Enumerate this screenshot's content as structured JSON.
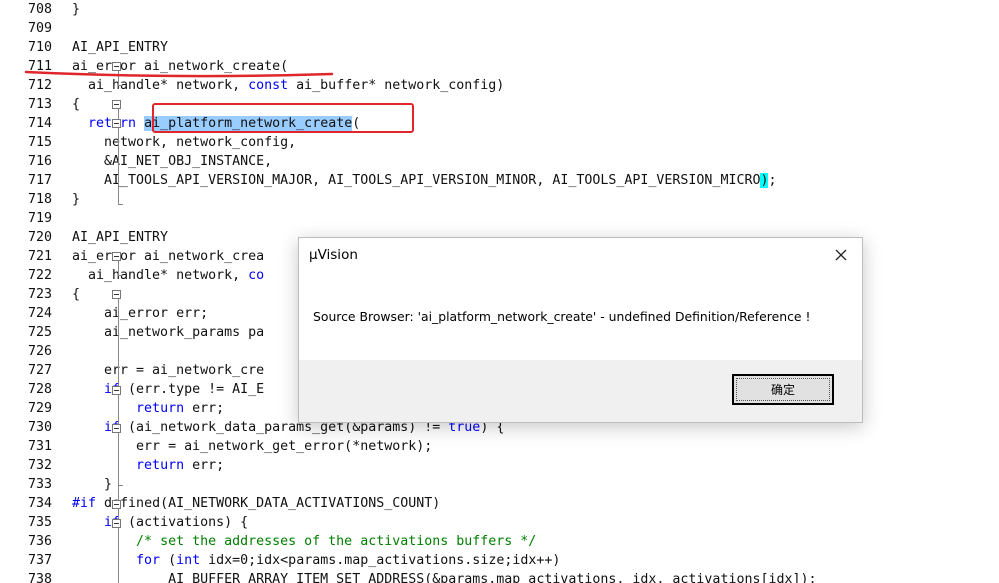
{
  "editor": {
    "lines": [
      {
        "n": "708",
        "segs": [
          {
            "t": "}"
          }
        ]
      },
      {
        "n": "709",
        "segs": []
      },
      {
        "n": "710",
        "segs": [
          {
            "t": "AI_API_ENTRY"
          }
        ]
      },
      {
        "n": "711",
        "segs": [
          {
            "t": "ai_error ai_network_create("
          }
        ]
      },
      {
        "n": "712",
        "segs": [
          {
            "t": "  ai_handle* network, "
          },
          {
            "t": "const",
            "c": "kw"
          },
          {
            "t": " ai_buffer* network_config)"
          }
        ]
      },
      {
        "n": "713",
        "segs": [
          {
            "t": "{"
          }
        ]
      },
      {
        "n": "714",
        "segs": [
          {
            "t": "  "
          },
          {
            "t": "return",
            "c": "kw"
          },
          {
            "t": " "
          },
          {
            "t": "ai_platform_network_create",
            "c": "hl"
          },
          {
            "t": "("
          }
        ]
      },
      {
        "n": "715",
        "segs": [
          {
            "t": "    network, network_config,"
          }
        ]
      },
      {
        "n": "716",
        "segs": [
          {
            "t": "    &AI_NET_OBJ_INSTANCE,"
          }
        ]
      },
      {
        "n": "717",
        "segs": [
          {
            "t": "    AI_TOOLS_API_VERSION_MAJOR, AI_TOOLS_API_VERSION_MINOR, AI_TOOLS_API_VERSION_MICRO"
          },
          {
            "t": ")",
            "c": "br"
          },
          {
            "t": ";"
          }
        ]
      },
      {
        "n": "718",
        "segs": [
          {
            "t": "}"
          }
        ]
      },
      {
        "n": "719",
        "segs": []
      },
      {
        "n": "720",
        "segs": [
          {
            "t": "AI_API_ENTRY"
          }
        ]
      },
      {
        "n": "721",
        "segs": [
          {
            "t": "ai_error ai_network_crea"
          }
        ]
      },
      {
        "n": "722",
        "segs": [
          {
            "t": "  ai_handle* network, "
          },
          {
            "t": "co",
            "c": "kw"
          }
        ]
      },
      {
        "n": "723",
        "segs": [
          {
            "t": "{"
          }
        ]
      },
      {
        "n": "724",
        "segs": [
          {
            "t": "    ai_error err;"
          }
        ]
      },
      {
        "n": "725",
        "segs": [
          {
            "t": "    ai_network_params pa"
          }
        ]
      },
      {
        "n": "726",
        "segs": []
      },
      {
        "n": "727",
        "segs": [
          {
            "t": "    err = ai_network_cre"
          }
        ]
      },
      {
        "n": "728",
        "segs": [
          {
            "t": "    "
          },
          {
            "t": "if",
            "c": "kw"
          },
          {
            "t": " (err.type != AI_E"
          }
        ]
      },
      {
        "n": "729",
        "segs": [
          {
            "t": "        "
          },
          {
            "t": "return",
            "c": "kw"
          },
          {
            "t": " err;"
          }
        ]
      },
      {
        "n": "730",
        "segs": [
          {
            "t": "    "
          },
          {
            "t": "if",
            "c": "kw"
          },
          {
            "t": " (ai_network_data_params_get(&params) != "
          },
          {
            "t": "true",
            "c": "kw"
          },
          {
            "t": ") {"
          }
        ]
      },
      {
        "n": "731",
        "segs": [
          {
            "t": "        err = ai_network_get_error(*network);"
          }
        ]
      },
      {
        "n": "732",
        "segs": [
          {
            "t": "        "
          },
          {
            "t": "return",
            "c": "kw"
          },
          {
            "t": " err;"
          }
        ]
      },
      {
        "n": "733",
        "segs": [
          {
            "t": "    }"
          }
        ]
      },
      {
        "n": "734",
        "segs": [
          {
            "t": "#if",
            "c": "kw"
          },
          {
            "t": " defined(AI_NETWORK_DATA_ACTIVATIONS_COUNT)"
          }
        ]
      },
      {
        "n": "735",
        "segs": [
          {
            "t": "    "
          },
          {
            "t": "if",
            "c": "kw"
          },
          {
            "t": " (activations) {"
          }
        ]
      },
      {
        "n": "736",
        "segs": [
          {
            "t": "        "
          },
          {
            "t": "/* set the addresses of the activations buffers */",
            "c": "cm"
          }
        ]
      },
      {
        "n": "737",
        "segs": [
          {
            "t": "        "
          },
          {
            "t": "for",
            "c": "kw"
          },
          {
            "t": " ("
          },
          {
            "t": "int",
            "c": "kw"
          },
          {
            "t": " idx=0;idx<params.map_activations.size;idx++)"
          }
        ]
      },
      {
        "n": "738",
        "segs": [
          {
            "t": "            AI_BUFFER_ARRAY_ITEM_SET_ADDRESS(&params.map_activations, idx, activations[idx]);"
          }
        ]
      }
    ]
  },
  "dialog": {
    "title": "µVision",
    "message": "Source Browser: 'ai_platform_network_create' - undefined Definition/Reference !",
    "ok_label": "确定"
  },
  "colors": {
    "keyword": "#0000ff",
    "comment": "#008000",
    "selection": "#99ccff",
    "brace_match": "#00ffff",
    "annotation_red": "#e0262a"
  }
}
